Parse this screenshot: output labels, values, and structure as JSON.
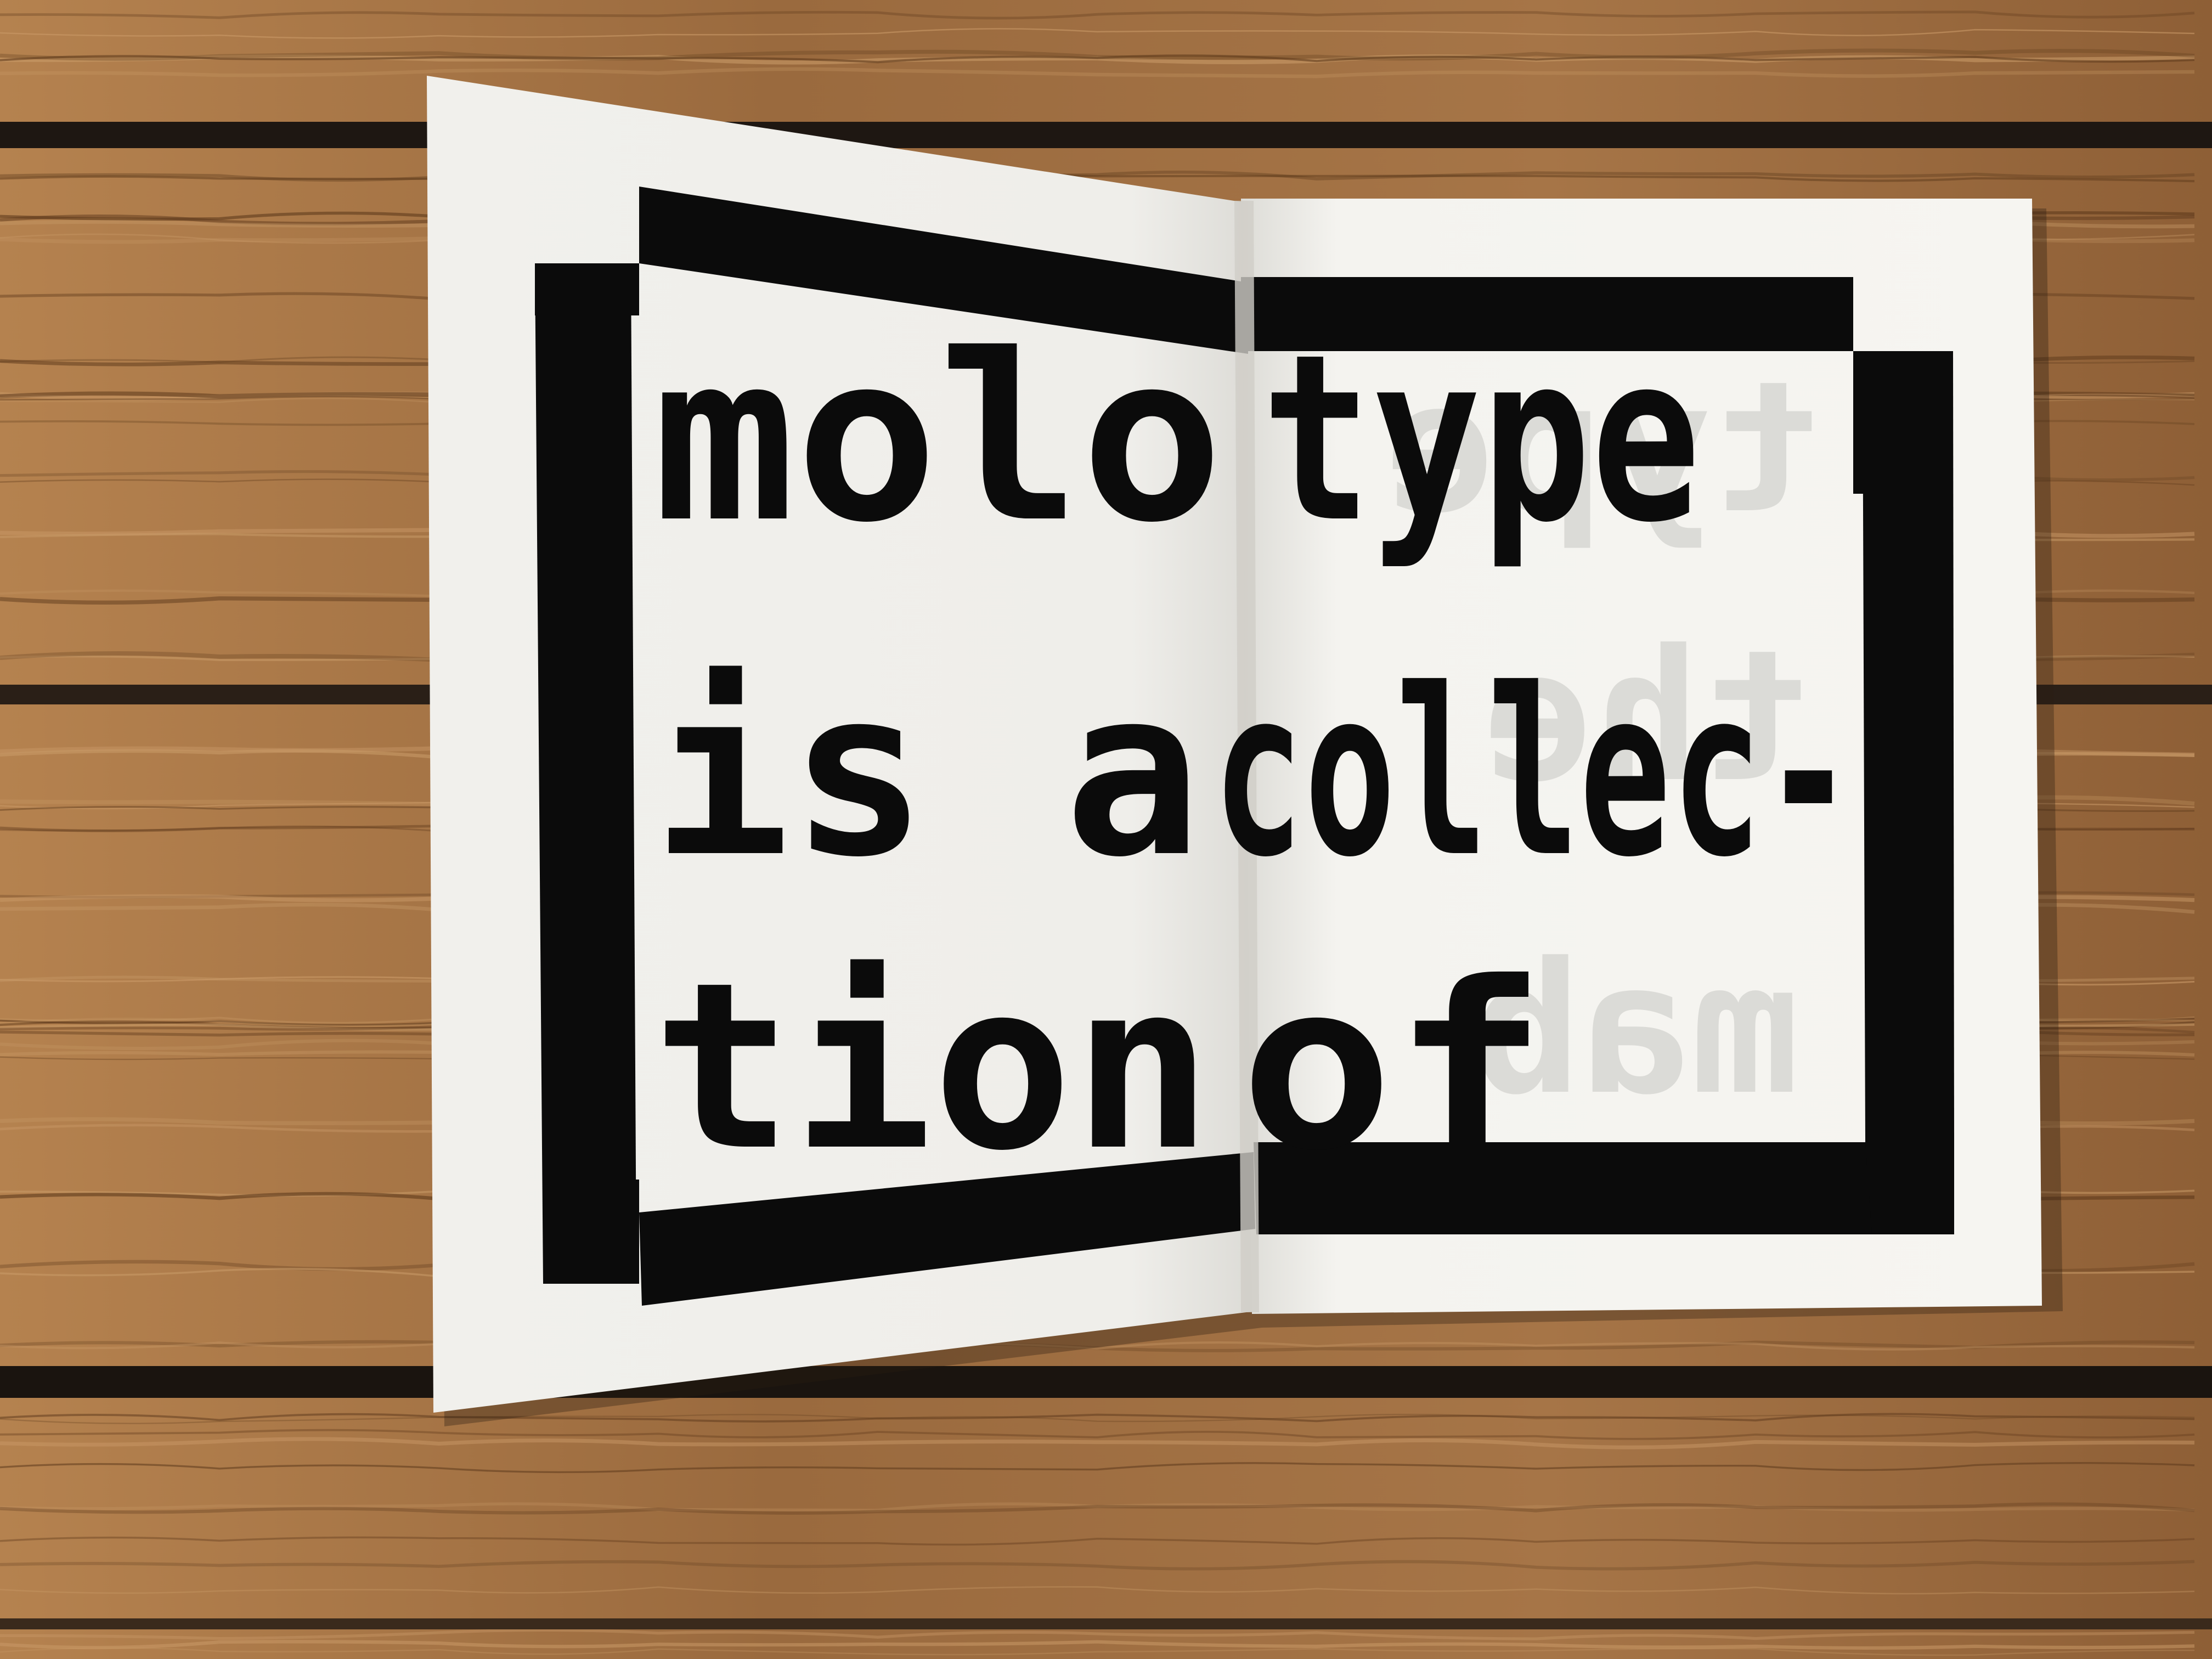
{
  "photo": {
    "subject": "open zine booklet on wooden floor",
    "colors": {
      "wood_dark": "#5e3a1c",
      "wood_mid": "#9a6a3e",
      "wood_light": "#c08e5c",
      "gap": "#1e1712",
      "paper": "#f4f3ef",
      "ink": "#0b0b0b",
      "ghost_ink": "#d9d8d4"
    }
  },
  "booklet": {
    "text_lines": [
      {
        "left": "molo",
        "right": "type"
      },
      {
        "left": "is a",
        "right": "collec-"
      },
      {
        "left": "tion",
        "right": "of"
      }
    ],
    "ghost_text": [
      "type",
      "the",
      "mab"
    ]
  }
}
